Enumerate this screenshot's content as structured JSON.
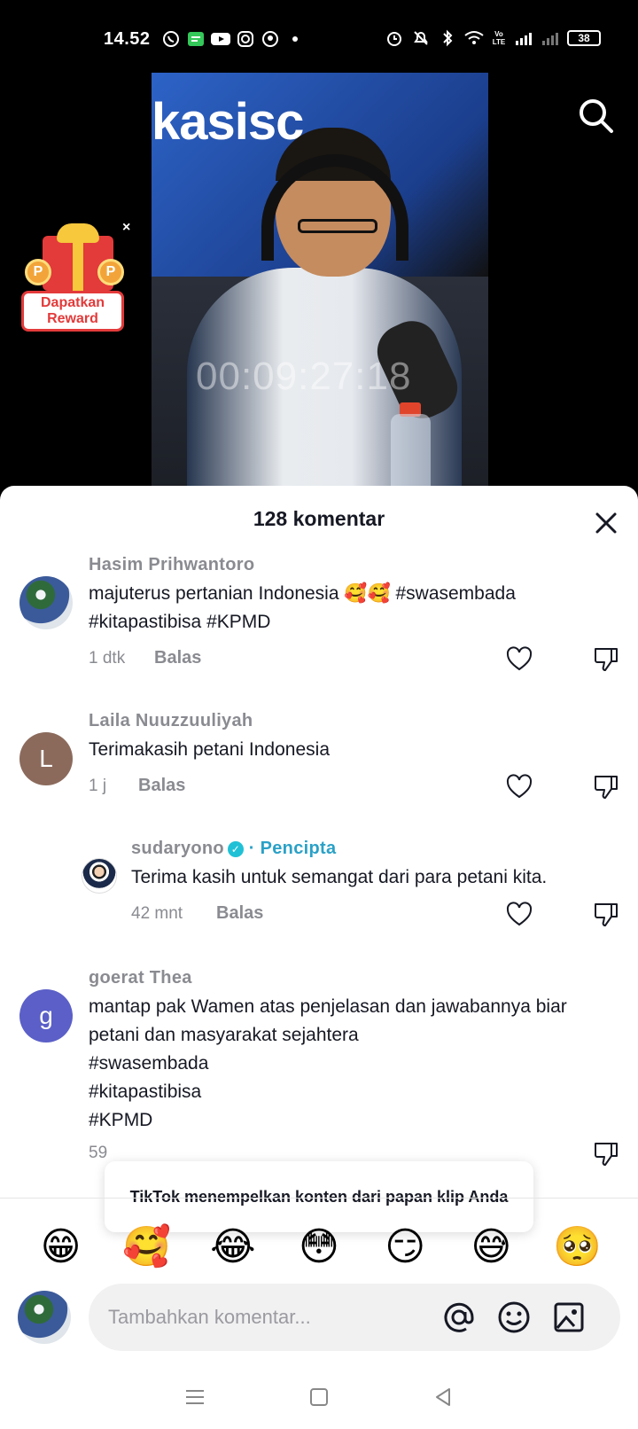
{
  "status_bar": {
    "time": "14.52",
    "battery": "38",
    "volte": "Vo LTE"
  },
  "video": {
    "banner_text": "kasisc",
    "timer": "00:09:27:18"
  },
  "reward": {
    "label": "Dapatkan Reward",
    "close": "×"
  },
  "sheet": {
    "title": "128 komentar"
  },
  "comments": [
    {
      "user": "Hasim Prihwantoro",
      "text": "majuterus pertanian Indonesia 🥰🥰 #swasembada #kitapastibisa #KPMD",
      "time": "1 dtk",
      "reply": "Balas"
    },
    {
      "user": "Laila Nuuzzuuliyah",
      "avatar_letter": "L",
      "text": "Terimakasih petani Indonesia",
      "time": "1 j",
      "reply": "Balas"
    },
    {
      "user": "sudaryono",
      "tag": "· Pencipta",
      "text": "Terima kasih untuk semangat dari para petani kita.",
      "time": "42 mnt",
      "reply": "Balas"
    },
    {
      "user": "goerat Thea",
      "avatar_letter": "g",
      "text_lines": [
        "mantap pak Wamen atas penjelasan dan jawabannya biar",
        "petani dan masyarakat sejahtera",
        "#swasembada",
        "#kitapastibisa",
        "#KPMD"
      ],
      "time": "59"
    }
  ],
  "toast": "TikTok menempelkan konten dari papan klip Anda",
  "emojis": [
    "😁",
    "🥰",
    "😂",
    "😳",
    "😏",
    "😅",
    "🥺"
  ],
  "input": {
    "placeholder": "Tambahkan komentar..."
  },
  "colors": {
    "creator_tag": "#2aa1c7",
    "reward_red": "#e33a3a",
    "muted_text": "#8a8b91"
  }
}
